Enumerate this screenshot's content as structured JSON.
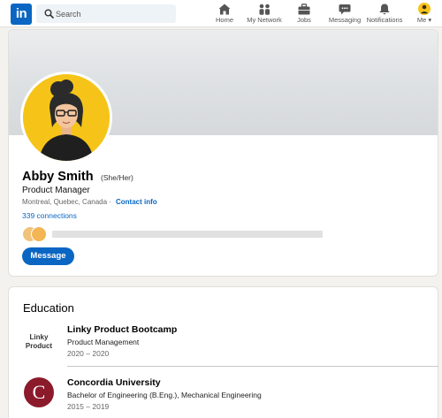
{
  "nav": {
    "logo": "in",
    "search_placeholder": "Search",
    "items": [
      {
        "label": "Home",
        "icon": "home-icon"
      },
      {
        "label": "My Network",
        "icon": "network-icon"
      },
      {
        "label": "Jobs",
        "icon": "briefcase-icon"
      },
      {
        "label": "Messaging",
        "icon": "messaging-icon"
      },
      {
        "label": "Notifications",
        "icon": "bell-icon"
      },
      {
        "label": "Me",
        "icon": "avatar-icon"
      }
    ]
  },
  "profile": {
    "name": "Abby Smith",
    "pronouns": "(She/Her)",
    "headline": "Product Manager",
    "location": "Montreal, Quebec, Canada ·",
    "contact_info": "Contact info",
    "connections": "339 connections",
    "message_label": "Message"
  },
  "education": {
    "title": "Education",
    "items": [
      {
        "logo_text_1": "Linky",
        "logo_text_2": "Product",
        "school": "Linky Product Bootcamp",
        "degree": "Product Management",
        "dates": "2020 – 2020"
      },
      {
        "logo_text_1": "C",
        "school": "Concordia University",
        "degree": "Bachelor of Engineering (B.Eng.), Mechanical Engineering",
        "dates": "2015 – 2019"
      }
    ]
  },
  "colors": {
    "brand": "#0a66c2",
    "avatar_bg": "#f6c418",
    "concordia": "#8b1a2b",
    "page_bg": "#f3f2ef"
  }
}
